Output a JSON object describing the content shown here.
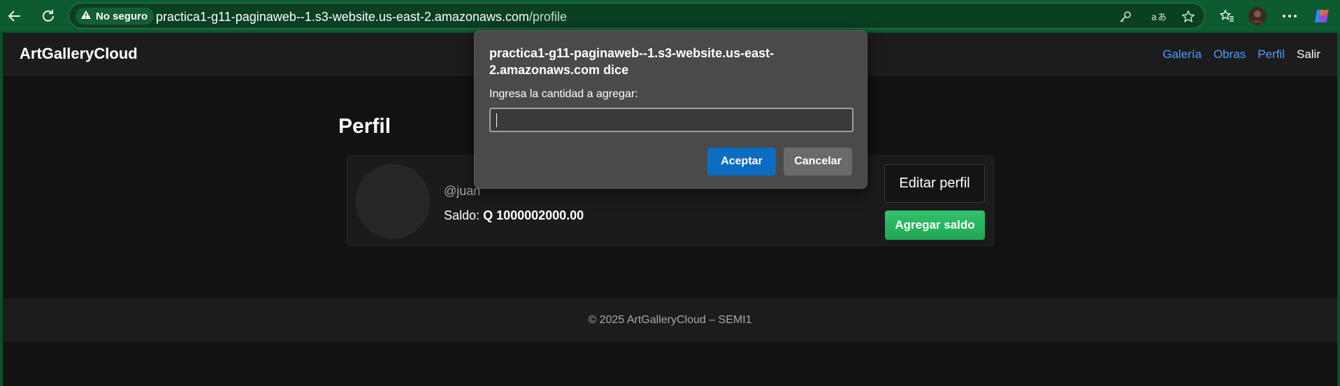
{
  "browser": {
    "security_label": "No seguro",
    "url_host": "practica1-g11-paginaweb--1.s3-website.us-east-2.amazonaws.com",
    "url_path": "/profile",
    "accent_color": "#0d5b30"
  },
  "site": {
    "brand": "ArtGalleryCloud",
    "nav": [
      "Galería",
      "Obras",
      "Perfil",
      "Salir"
    ]
  },
  "profile": {
    "title": "Perfil",
    "handle": "@juan",
    "saldo_label": "Saldo:",
    "saldo_value": "Q 1000002000.00",
    "edit_button": "Editar perfil",
    "add_button": "Agregar saldo"
  },
  "footer": {
    "text": "© 2025 ArtGalleryCloud – SEMI1"
  },
  "dialog": {
    "title": "practica1-g11-paginaweb--1.s3-website.us-east-2.amazonaws.com dice",
    "message": "Ingresa la cantidad a agregar:",
    "input_value": "",
    "ok_label": "Aceptar",
    "cancel_label": "Cancelar"
  }
}
